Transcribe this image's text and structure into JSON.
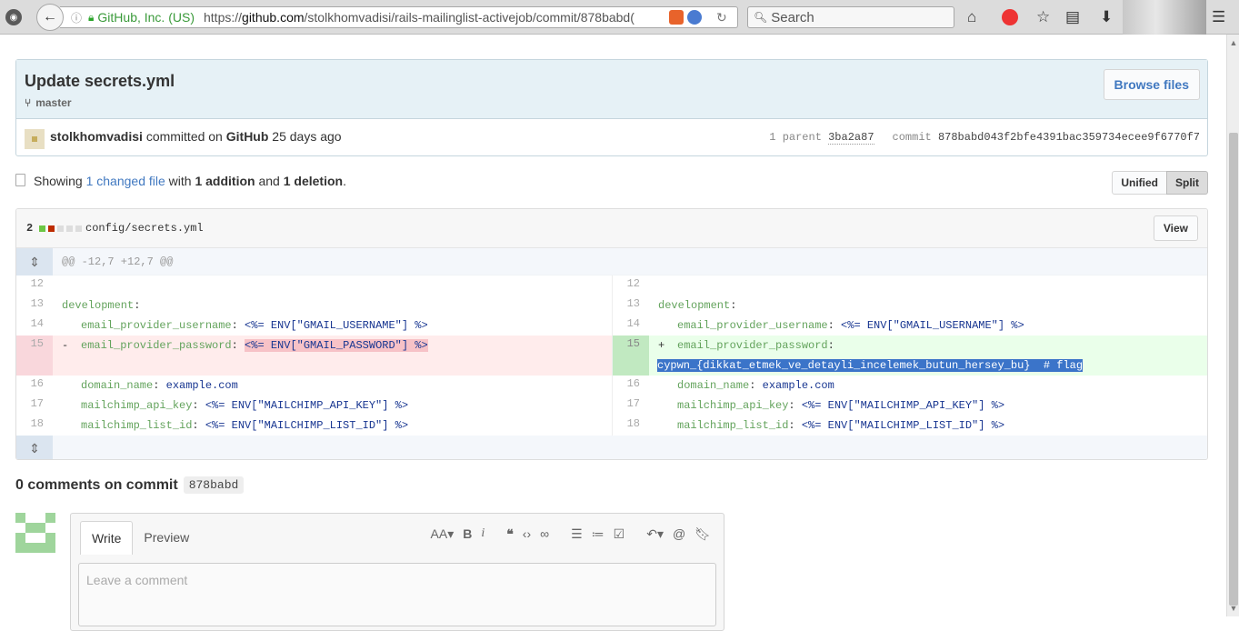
{
  "browser": {
    "org_label": "GitHub, Inc. (US)",
    "url_scheme": "https://",
    "url_host": "github.com",
    "url_path": "/stolkhomvadisi/rails-mailinglist-activejob/commit/878babd(",
    "search_placeholder": "Search"
  },
  "commit": {
    "title": "Update secrets.yml",
    "branch": "master",
    "browse_label": "Browse files",
    "author": "stolkhomvadisi",
    "committed_text": "committed on",
    "committer": "GitHub",
    "time": "25 days ago",
    "parent_label": "1 parent",
    "parent_sha": "3ba2a87",
    "commit_label": "commit",
    "commit_sha": "878babd043f2bfe4391bac359734ecee9f6770f7"
  },
  "toc": {
    "showing": "Showing",
    "changed": "1 changed file",
    "with": "with",
    "additions": "1 addition",
    "and": "and",
    "deletions": "1 deletion",
    "period": ".",
    "unified_label": "Unified",
    "split_label": "Split"
  },
  "file": {
    "diffstat_count": "2",
    "path": "config/secrets.yml",
    "view_label": "View",
    "hunk_header": "@@ -12,7 +12,7 @@",
    "left": {
      "l12": "12",
      "l13": "13",
      "l14": "14",
      "l15": "15",
      "l16": "16",
      "l17": "17",
      "l18": "18",
      "marker_del": "-"
    },
    "right": {
      "l12": "12",
      "l13": "13",
      "l14": "14",
      "l15": "15",
      "l16": "16",
      "l17": "17",
      "l18": "18",
      "marker_add": "+",
      "flag_line": "cypwn_{dikkat_etmek_ve_detayli_incelemek_butun_hersey_bu}  # flag"
    },
    "code": {
      "development_key": "development",
      "colon": ":",
      "gmail_user_key": "email_provider_username",
      "gmail_user_val": "<%= ENV[\"GMAIL_USERNAME\"] %>",
      "gmail_pass_key": "email_provider_password",
      "gmail_pass_val": "<%= ENV[\"GMAIL_PASSWORD\"] %>",
      "domain_key": "domain_name",
      "domain_val": "example.com",
      "mc_api_key": "mailchimp_api_key",
      "mc_api_val": "<%= ENV[\"MAILCHIMP_API_KEY\"] %>",
      "mc_list_key": "mailchimp_list_id",
      "mc_list_val": "<%= ENV[\"MAILCHIMP_LIST_ID\"] %>"
    }
  },
  "comments": {
    "heading": "0 comments on commit",
    "sha": "878babd",
    "tab_write": "Write",
    "tab_preview": "Preview",
    "placeholder": "Leave a comment"
  },
  "icons": {
    "toolbar": [
      "rss-icon",
      "back-arrow-icon",
      "info-icon",
      "lock-icon",
      "reload-icon",
      "search-icon",
      "home-icon",
      "star-icon",
      "reader-icon",
      "download-icon",
      "menu-icon"
    ]
  },
  "colors": {
    "link": "#4078c0",
    "addition": "#eaffea",
    "deletion": "#ffecec",
    "selection": "#3b74c9"
  }
}
